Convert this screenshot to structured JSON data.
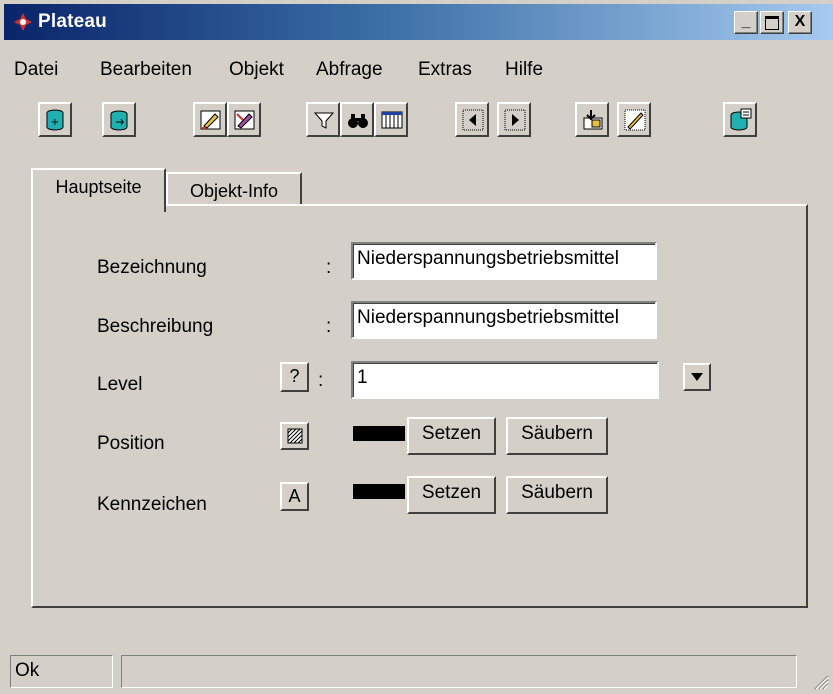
{
  "window": {
    "title": "Plateau"
  },
  "title_buttons": {
    "minimize": "_",
    "maximize": "□",
    "close": "X"
  },
  "menu": [
    "Datei",
    "Bearbeiten",
    "Objekt",
    "Abfrage",
    "Extras",
    "Hilfe"
  ],
  "toolbar": [
    {
      "icon": "database-add-icon"
    },
    {
      "icon": "database-refresh-icon"
    },
    {
      "icon": "edit-pencil-icon"
    },
    {
      "icon": "edit-clear-icon"
    },
    {
      "icon": "filter-icon"
    },
    {
      "icon": "binoculars-icon"
    },
    {
      "icon": "table-columns-icon"
    },
    {
      "icon": "previous-arrow-icon"
    },
    {
      "icon": "next-arrow-icon"
    },
    {
      "icon": "insert-icon"
    },
    {
      "icon": "draw-icon"
    },
    {
      "icon": "database-export-icon"
    }
  ],
  "tabs": {
    "main": "Hauptseite",
    "info": "Objekt-Info"
  },
  "form": {
    "bezeichnung": {
      "label": "Bezeichnung",
      "value": "Niederspannungsbetriebsmittel"
    },
    "beschreibung": {
      "label": "Beschreibung",
      "value": "Niederspannungsbetriebsmittel"
    },
    "level": {
      "label": "Level",
      "help": "?",
      "value": "1"
    },
    "position": {
      "label": "Position",
      "set": "Setzen",
      "clear": "Säubern"
    },
    "kennzeichen": {
      "label": "Kennzeichen",
      "font_button": "A",
      "set": "Setzen",
      "clear": "Säubern"
    },
    "colon": ":"
  },
  "status": {
    "text": "Ok",
    "second": ""
  },
  "colors": {
    "title_start": "#0a246a",
    "title_end": "#a6caf0",
    "face": "#d4d0c8"
  }
}
